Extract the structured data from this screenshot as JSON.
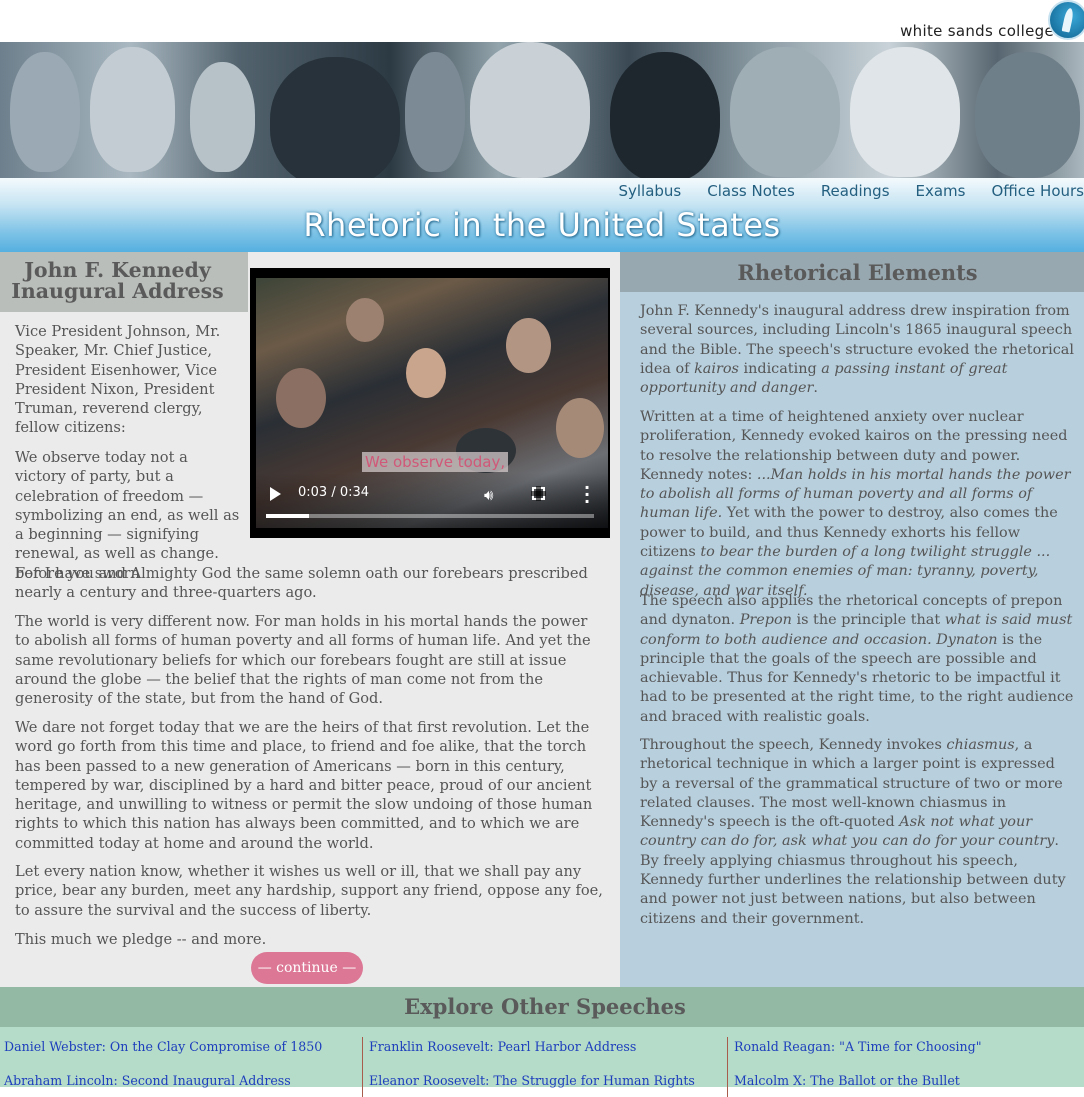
{
  "brand": {
    "name": "white sands college",
    "logo_icon": "wave-logo-icon"
  },
  "banner": {
    "image_alt": "portrait collage banner"
  },
  "nav": {
    "items": [
      "Syllabus",
      "Class Notes",
      "Readings",
      "Exams",
      "Office Hours"
    ]
  },
  "site_title": "Rhetoric in the United States",
  "speech": {
    "heading_line1": "John F. Kennedy",
    "heading_line2": "Inaugural Address",
    "salutation": "Vice President Johnson, Mr. Speaker, Mr. Chief Justice, President Eisenhower, Vice President Nixon, President Truman, reverend clergy, fellow citizens:",
    "p1_a": "We observe today not a victory of party, but a celebration of freedom — symbolizing an end, as well as a beginning — signifying renewal, as well as change. For I have sworn",
    "p1_b": "before you and Almighty God the same solemn oath our forebears prescribed nearly a century and three-quarters ago.",
    "p2": "The world is very different now. For man holds in his mortal hands the power to abolish all forms of human poverty and all forms of human life. And yet the same revolutionary beliefs for which our forebears fought are still at issue around the globe — the belief that the rights of man come not from the generosity of the state, but from the hand of God.",
    "p3": "We dare not forget today that we are the heirs of that first revolution. Let the word go forth from this time and place, to friend and foe alike, that the torch has been passed to a new generation of Americans — born in this century, tempered by war, disciplined by a hard and bitter peace, proud of our ancient heritage, and unwilling to witness or permit the slow undoing of those human rights to which this nation has always been committed, and to which we are committed today at home and around the world.",
    "p4": "Let every nation know, whether it wishes us well or ill, that we shall pay any price, bear any burden, meet any hardship, support any friend, oppose any foe, to assure the survival and the success of liberty.",
    "p5": "This much we pledge -- and more.",
    "continue_label": "— continue —"
  },
  "video": {
    "caption": "We observe today,",
    "time": "0:03 / 0:34",
    "progress_fraction": 0.13,
    "icons": [
      "play-icon",
      "volume-icon",
      "fullscreen-icon",
      "more-options-icon"
    ]
  },
  "rhetoric": {
    "heading": "Rhetorical Elements",
    "r1_plain1": "John F. Kennedy's inaugural address drew inspiration from several sources, including Lincoln's 1865 inaugural speech and the Bible. The speech's structure evoked the rhetorical idea of ",
    "r1_italic1": "kairos",
    "r1_plain2": " indicating ",
    "r1_italic2": "a passing instant of great opportunity and danger",
    "r1_plain3": ".",
    "r2_plain1": "Written at a time of heightened anxiety over nuclear proliferation, Kennedy evoked kairos on the pressing need to resolve the relationship between duty and power. Kennedy notes: ",
    "r2_italic1": "...Man holds in his mortal hands the power to abolish all forms of human poverty and all forms of human life.",
    "r2_plain2": " Yet with the power to destroy, also comes the power to build, and thus Kennedy exhorts his fellow citizens ",
    "r2_italic2": "to bear the burden of a long twilight struggle ... against the common enemies of man: tyranny, poverty, disease, and war itself.",
    "r3_plain1": "The speech also applies the rhetorical concepts of prepon and dynaton. ",
    "r3_italic1": "Prepon",
    "r3_plain2": " is the principle that ",
    "r3_italic2": "what is said must conform to both audience and occasion. Dynaton",
    "r3_plain3": " is the principle that the goals of the speech are possible and achievable. Thus for Kennedy's rhetoric to be impactful it had to be presented at the right time, to the right audience and braced with realistic goals.",
    "r4_plain1": "Throughout the speech, Kennedy invokes ",
    "r4_italic1": "chiasmus",
    "r4_plain2": ", a rhetorical technique in which a larger point is expressed by a reversal of the grammatical structure of two or more related clauses. The most well-known chiasmus in Kennedy's speech is the oft-quoted ",
    "r4_italic2": "Ask not what your country can do for, ask what you can do for your country",
    "r4_plain3": ". By freely applying chiasmus throughout his speech, Kennedy further underlines the relationship between duty and power not just between nations, but also between citizens and their government."
  },
  "explore": {
    "heading": "Explore Other Speeches",
    "columns": [
      [
        "Daniel Webster: On the Clay Compromise of 1850",
        "Abraham Lincoln: Second Inaugural Address"
      ],
      [
        "Franklin Roosevelt: Pearl Harbor Address",
        "Eleanor Roosevelt: The Struggle for Human Rights"
      ],
      [
        "Ronald Reagan: \"A Time for Choosing\"",
        "Malcolm X: The Ballot or the Bullet"
      ]
    ]
  },
  "colors": {
    "title_blue": "#55b0e0",
    "nav_link": "#245f80",
    "left_panel": "#ebebeb",
    "right_panel": "#b8cfdd",
    "explore_panel": "#b5dcc8",
    "continue_pink": "#dc7896",
    "link_blue": "#1d3ebd"
  }
}
